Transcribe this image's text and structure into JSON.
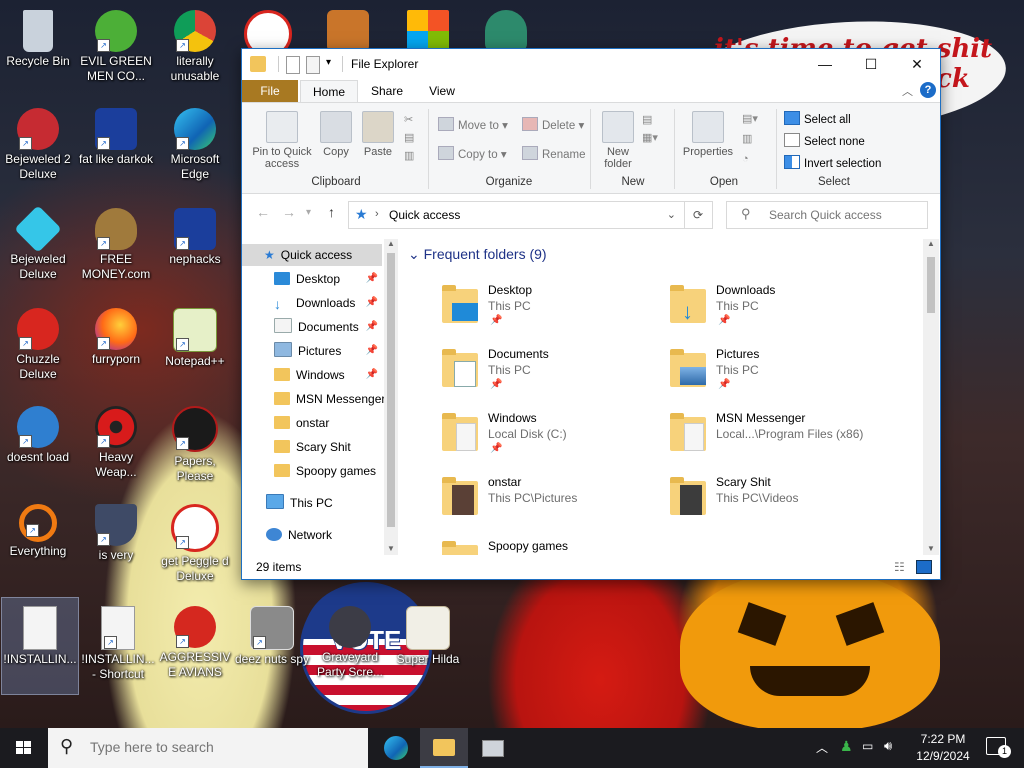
{
  "desktop": {
    "icons": [
      {
        "label": "Recycle Bin"
      },
      {
        "label": "EVIL GREEN MEN CO..."
      },
      {
        "label": "literally unusable"
      },
      {
        "label": "Bejeweled 2 Deluxe"
      },
      {
        "label": "fat like darkok"
      },
      {
        "label": "Microsoft Edge"
      },
      {
        "label": "Bejeweled Deluxe"
      },
      {
        "label": "FREE MONEY.com"
      },
      {
        "label": "nephacks"
      },
      {
        "label": "Chuzzle Deluxe"
      },
      {
        "label": "furryporn"
      },
      {
        "label": "Notepad++"
      },
      {
        "label": "doesnt load"
      },
      {
        "label": "Heavy Weap..."
      },
      {
        "label": "Papers, Please"
      },
      {
        "label": "Everything"
      },
      {
        "label": "is very"
      },
      {
        "label": "get Peggle d Deluxe"
      },
      {
        "label": "!INSTALLIN..."
      },
      {
        "label": "!INSTALLIN... - Shortcut"
      },
      {
        "label": "AGGRESSIVE AVIANS"
      },
      {
        "label": "deez nuts spy"
      },
      {
        "label": "Graveyard Party Scre..."
      },
      {
        "label": "Super Hilda"
      }
    ],
    "bubble_text": "it's time to get shit",
    "bubble_text_2": "ck",
    "sticker_text": "VOTE"
  },
  "explorer": {
    "title": "File Explorer",
    "window_controls": {
      "minimize": "—",
      "maximize": "☐",
      "close": "✕"
    },
    "tabs": [
      "File",
      "Home",
      "Share",
      "View"
    ],
    "ribbon": {
      "clipboard": {
        "group": "Clipboard",
        "pin": "Pin to Quick access",
        "copy": "Copy",
        "paste": "Paste"
      },
      "organize": {
        "group": "Organize",
        "move_to": "Move to",
        "copy_to": "Copy to",
        "delete": "Delete",
        "rename": "Rename"
      },
      "new": {
        "group": "New",
        "new_folder": "New folder"
      },
      "open": {
        "group": "Open",
        "properties": "Properties"
      },
      "select": {
        "group": "Select",
        "select_all": "Select all",
        "select_none": "Select none",
        "invert": "Invert selection"
      }
    },
    "address": {
      "path": "Quick access",
      "search_placeholder": "Search Quick access"
    },
    "nav": {
      "quick_access": "Quick access",
      "items": [
        {
          "label": "Desktop",
          "pinned": true
        },
        {
          "label": "Downloads",
          "pinned": true
        },
        {
          "label": "Documents",
          "pinned": true
        },
        {
          "label": "Pictures",
          "pinned": true
        },
        {
          "label": "Windows",
          "pinned": true
        },
        {
          "label": "MSN Messenger",
          "pinned": false
        },
        {
          "label": "onstar",
          "pinned": false
        },
        {
          "label": "Scary Shit",
          "pinned": false
        },
        {
          "label": "Spoopy games",
          "pinned": false
        }
      ],
      "this_pc": "This PC",
      "network": "Network"
    },
    "content": {
      "section_title": "Frequent folders (9)",
      "folders": [
        {
          "name": "Desktop",
          "location": "This PC"
        },
        {
          "name": "Downloads",
          "location": "This PC"
        },
        {
          "name": "Documents",
          "location": "This PC"
        },
        {
          "name": "Pictures",
          "location": "This PC"
        },
        {
          "name": "Windows",
          "location": "Local Disk (C:)"
        },
        {
          "name": "MSN Messenger",
          "location": "Local...\\Program Files (x86)"
        },
        {
          "name": "onstar",
          "location": "This PC\\Pictures"
        },
        {
          "name": "Scary Shit",
          "location": "This PC\\Videos"
        },
        {
          "name": "Spoopy games",
          "location": ""
        }
      ]
    },
    "status": {
      "item_count": "29 items"
    }
  },
  "taskbar": {
    "search_placeholder": "Type here to search",
    "time": "7:22 PM",
    "date": "12/9/2024",
    "notification_count": "1"
  }
}
